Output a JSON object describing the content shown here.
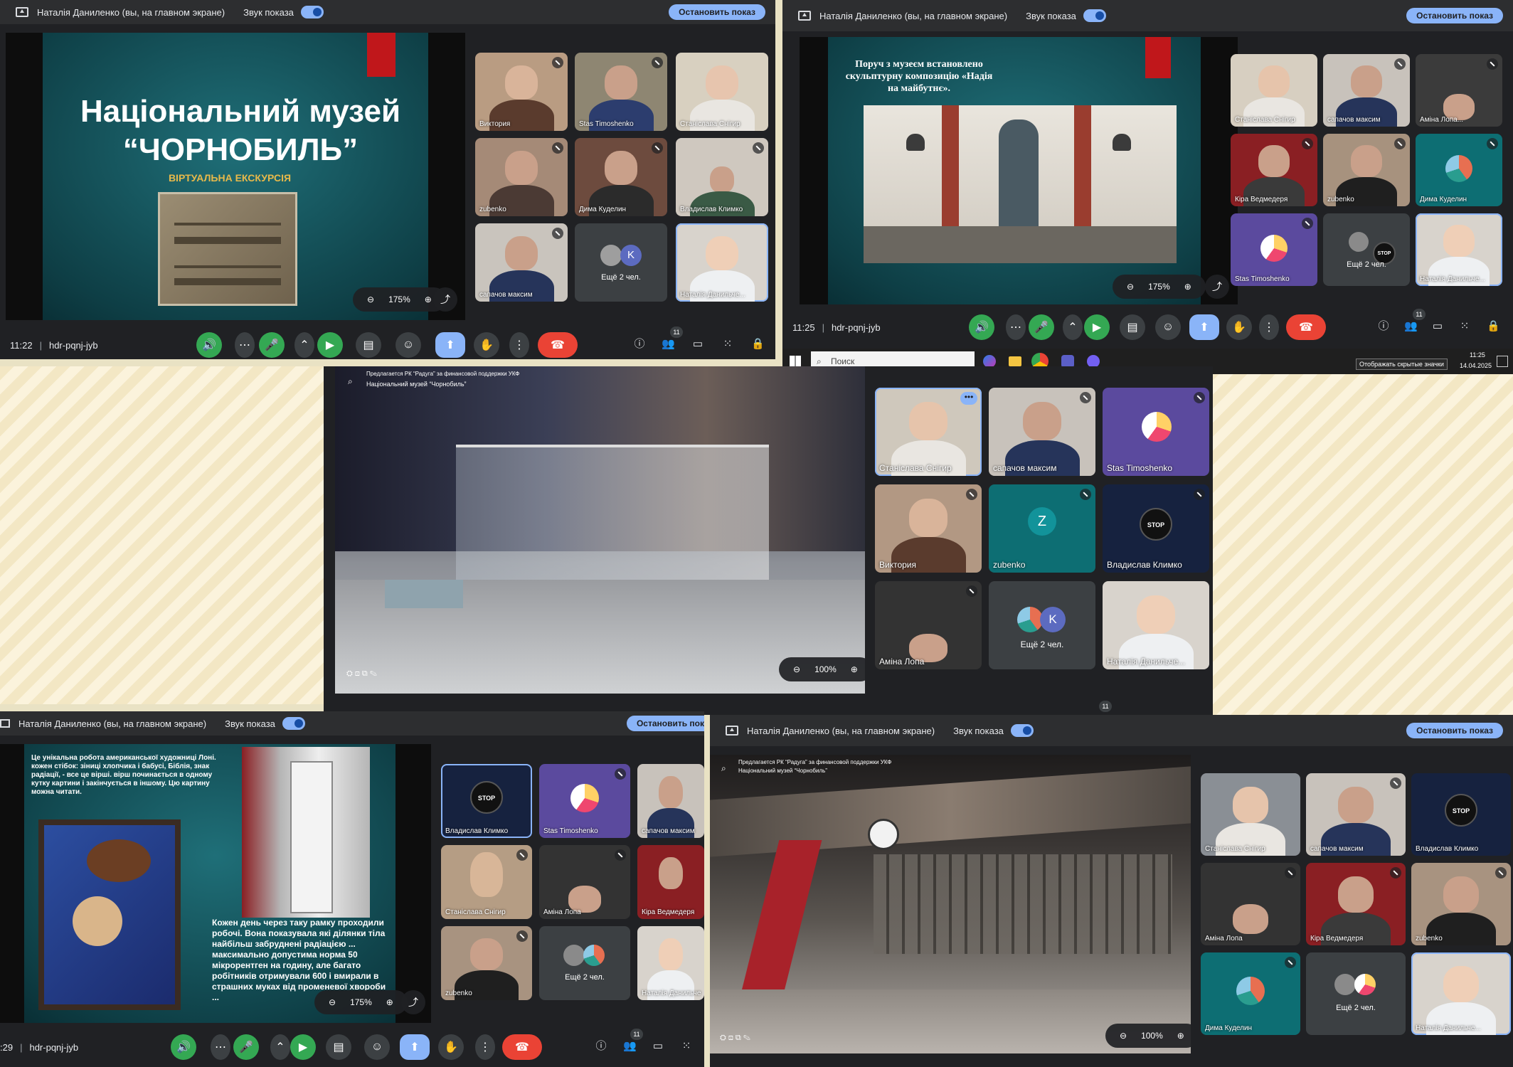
{
  "presenter_bar": {
    "presenter": "Наталія Даниленко (вы, на главном экране)",
    "sound_label": "Звук показа",
    "stop_button": "Остановить показ",
    "stop_button_cut": "Остановить пок"
  },
  "meeting": {
    "code": "hdr-pqnj-jyb",
    "time_1": "11:22",
    "time_2": "11:25",
    "time_5": ":29",
    "participants_count": "11"
  },
  "slides": {
    "s1_title": "Національний музей “ЧОРНОБИЛЬ”",
    "s1_subtitle": "ВІРТУАЛЬНА ЕКСКУРСІЯ",
    "s2_text": "Поруч з музеєм встановлено скульптурну композицію «Надія на майбутнє».",
    "s5_text_top": "Це унікальна робота американської художниці Лоні. кожен стібок: зіниці хлопчика і бабусі, Біблія, знак радіації, - все це вірші. вірш починається в одному кутку картини і закінчується в іншому. Цю картину можна читати.",
    "s5_text_bottom": "Кожен день через таку рамку проходили робочі. Вона показувала які ділянки тіла найбільш забруднені радіацією ... максимально допустима норма 50 мікрорентген на годину, але багато робітників отримували 600 і вмирали в страшних муках від променевої хвороби ...",
    "tour_caption_1": "Предлагается РК “Радуга” за финансовой поддержки УКФ",
    "tour_caption_2": "Національний музей “Чорнобиль”"
  },
  "zoom": {
    "z175": "175%",
    "z100": "100%"
  },
  "tiles": {
    "viktoria": "Виктория",
    "stas": "Stas Timoshenko",
    "stanislava": "Станіслава Снігир",
    "zubenko": "zubenko",
    "dima": "Дима Куделин",
    "vladyslav": "Владислав Климко",
    "sapachov": "сапачов максим",
    "more": "Ещё 2 чел.",
    "natalia": "Наталія Данильче...",
    "natalia_cut": "Наталія Данильче",
    "amina": "Аміна Лопа",
    "amina_cut": "Аміна Лопа...",
    "kira": "Кіра Ведмедеря",
    "letter_k": "K",
    "letter_z": "Z",
    "stop": "STOP"
  },
  "taskbar": {
    "search_placeholder": "Поиск",
    "tooltip": "Отображать скрытые значки",
    "clock_time": "11:25",
    "clock_date": "14.04.2025"
  },
  "colors": {
    "accent": "#8ab4f8",
    "green": "#34a853",
    "red": "#ea4335",
    "bg": "#202124"
  }
}
